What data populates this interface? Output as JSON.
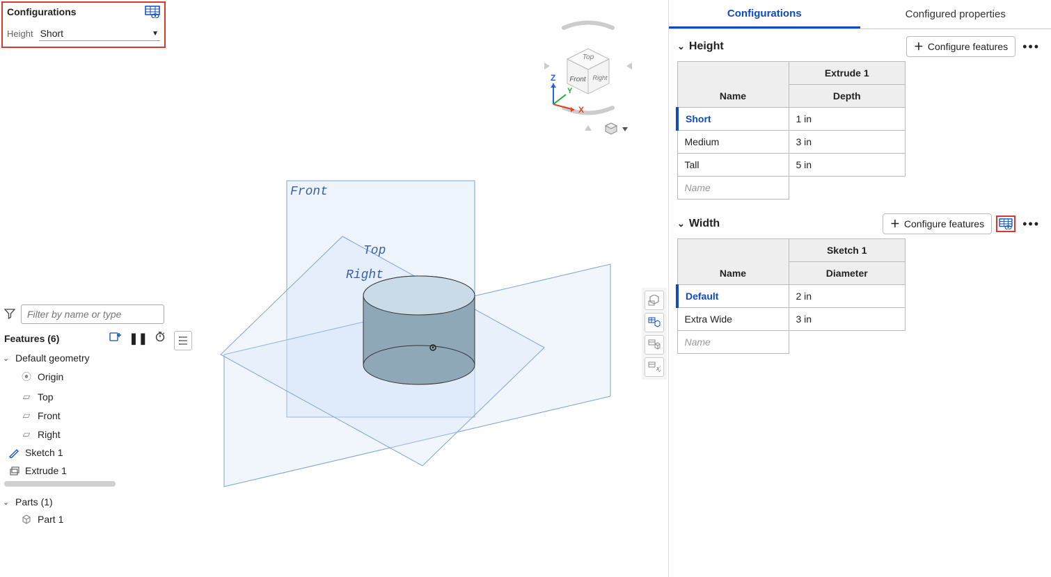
{
  "configBox": {
    "title": "Configurations",
    "paramLabel": "Height",
    "paramValue": "Short"
  },
  "featurePanel": {
    "filterPlaceholder": "Filter by name or type",
    "header": "Features (6)",
    "group": "Default geometry",
    "items": {
      "origin": "Origin",
      "top": "Top",
      "front": "Front",
      "right": "Right"
    },
    "sketch": "Sketch 1",
    "extrude": "Extrude 1",
    "partsHeader": "Parts (1)",
    "part": "Part 1"
  },
  "viewport": {
    "planeFront": "Front",
    "planeTop": "Top",
    "planeRight": "Right"
  },
  "triad": {
    "x": "X",
    "y": "Y",
    "z": "Z",
    "cubeTop": "Top",
    "cubeFront": "Front",
    "cubeRight": "Right"
  },
  "rightPanel": {
    "tabConfigurations": "Configurations",
    "tabConfiguredProps": "Configured properties",
    "heightSection": {
      "title": "Height",
      "configureBtn": "Configure features",
      "featureHeader": "Extrude 1",
      "colName": "Name",
      "colValue": "Depth",
      "rows": [
        {
          "name": "Short",
          "value": "1 in"
        },
        {
          "name": "Medium",
          "value": "3 in"
        },
        {
          "name": "Tall",
          "value": "5 in"
        }
      ],
      "placeholder": "Name"
    },
    "widthSection": {
      "title": "Width",
      "configureBtn": "Configure features",
      "featureHeader": "Sketch 1",
      "colName": "Name",
      "colValue": "Diameter",
      "rows": [
        {
          "name": "Default",
          "value": "2 in"
        },
        {
          "name": "Extra Wide",
          "value": "3 in"
        }
      ],
      "placeholder": "Name"
    }
  }
}
